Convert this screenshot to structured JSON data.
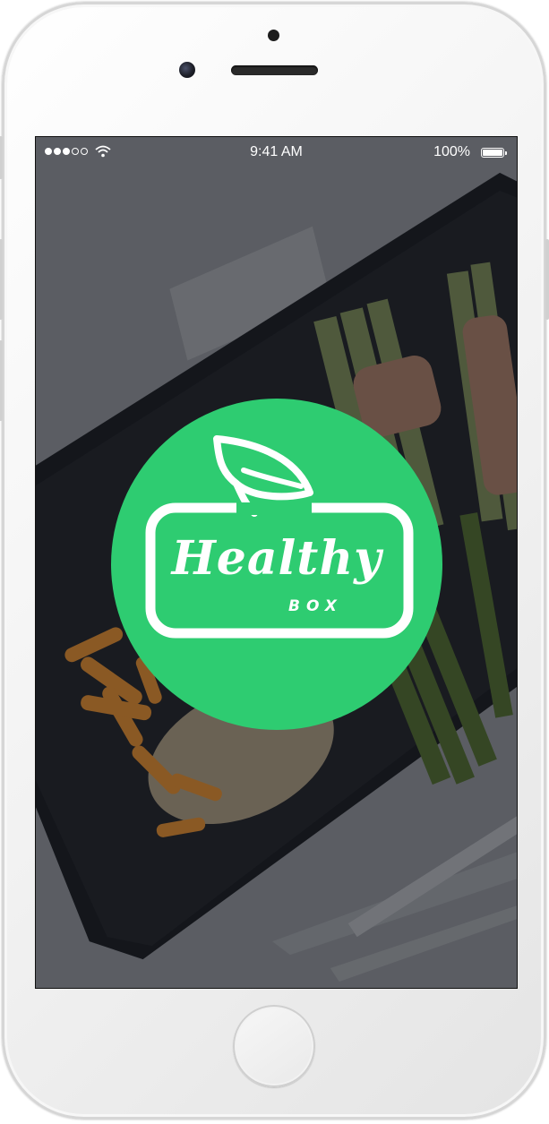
{
  "device": {
    "frame_color": "#f1f1f1",
    "screen_overlay": "#14161c"
  },
  "status_bar": {
    "signal_bars_filled": 3,
    "signal_bars_total": 5,
    "wifi_icon": "wifi-icon",
    "time": "9:41 AM",
    "battery_percent": "100%",
    "battery_icon": "battery-icon",
    "battery_level": 1.0
  },
  "splash": {
    "brand_color": "#2ecc71",
    "logo_icon": "leaf-icon",
    "logo_word": "Healthy",
    "logo_sub": "BOX"
  }
}
